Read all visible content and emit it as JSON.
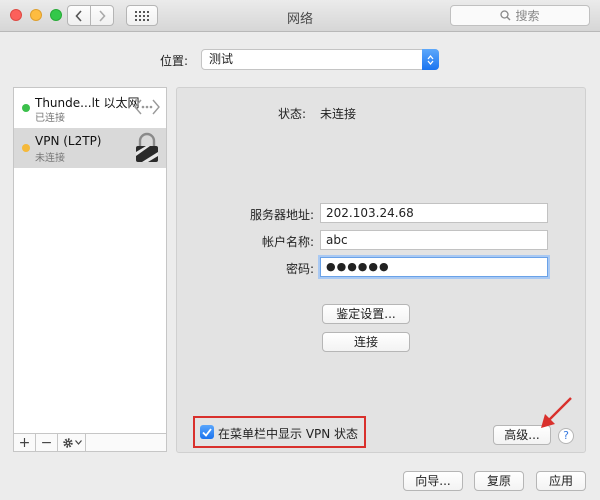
{
  "window": {
    "title": "网络"
  },
  "search": {
    "placeholder": "搜索"
  },
  "location": {
    "label": "位置:",
    "value": "测试"
  },
  "services": [
    {
      "name": "Thunde...lt 以太网",
      "status": "已连接",
      "dot": "green",
      "icon": "ethernet-icon"
    },
    {
      "name": "VPN (L2TP)",
      "status": "未连接",
      "dot": "amber",
      "icon": "lock-icon"
    }
  ],
  "toolbar": {
    "add": "+",
    "remove": "−"
  },
  "detail": {
    "status_label": "状态:",
    "status_value": "未连接",
    "server_label": "服务器地址:",
    "server_value": "202.103.24.68",
    "account_label": "帐户名称:",
    "account_value": "abc",
    "password_label": "密码:",
    "password_value": "●●●●●●",
    "auth_button": "鉴定设置...",
    "connect_button": "连接",
    "show_vpn_label": "在菜单栏中显示 VPN 状态",
    "show_vpn_checked": true,
    "advanced_button": "高级...",
    "help": "?"
  },
  "footer": {
    "assist": "向导...",
    "revert": "复原",
    "apply": "应用"
  },
  "colors": {
    "accent": "#1b73ef",
    "highlight_box": "#d9302c",
    "arrow": "#d9302c"
  }
}
